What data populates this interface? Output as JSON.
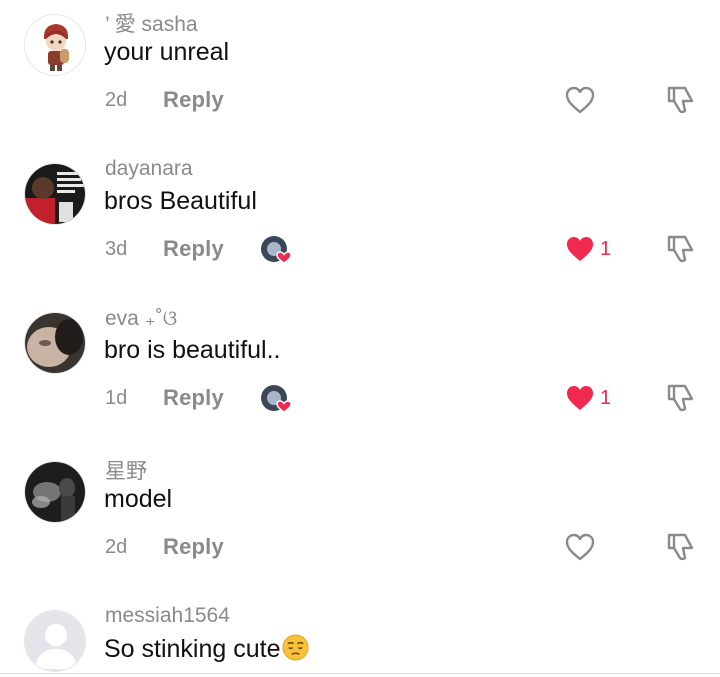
{
  "comments": [
    {
      "username": "’ 愛 sasha",
      "text": "your unreal",
      "time": "2d",
      "reply": "Reply",
      "liked": false,
      "like_count": "",
      "creator_liked": false,
      "avatar": "chibi-avatar"
    },
    {
      "username": "dayanara",
      "text": "bros Beautiful",
      "time": "3d",
      "reply": "Reply",
      "liked": true,
      "like_count": "1",
      "creator_liked": true,
      "avatar": "meme-avatar"
    },
    {
      "username": "eva ₊˚ଓ",
      "text": "bro is beautiful..",
      "time": "1d",
      "reply": "Reply",
      "liked": true,
      "like_count": "1",
      "creator_liked": true,
      "avatar": "face-avatar"
    },
    {
      "username": "星野",
      "text": "model",
      "time": "2d",
      "reply": "Reply",
      "liked": false,
      "like_count": "",
      "creator_liked": false,
      "avatar": "smoke-avatar"
    },
    {
      "username": "messiah1564",
      "text": "So stinking cute",
      "text_emoji": "pensive-face-emoji",
      "time": "",
      "reply": "",
      "liked": false,
      "like_count": "",
      "creator_liked": false,
      "avatar": "default-avatar"
    }
  ],
  "colors": {
    "like_red": "#ef2950",
    "meta_gray": "#8a8a8a",
    "text": "#111111"
  }
}
